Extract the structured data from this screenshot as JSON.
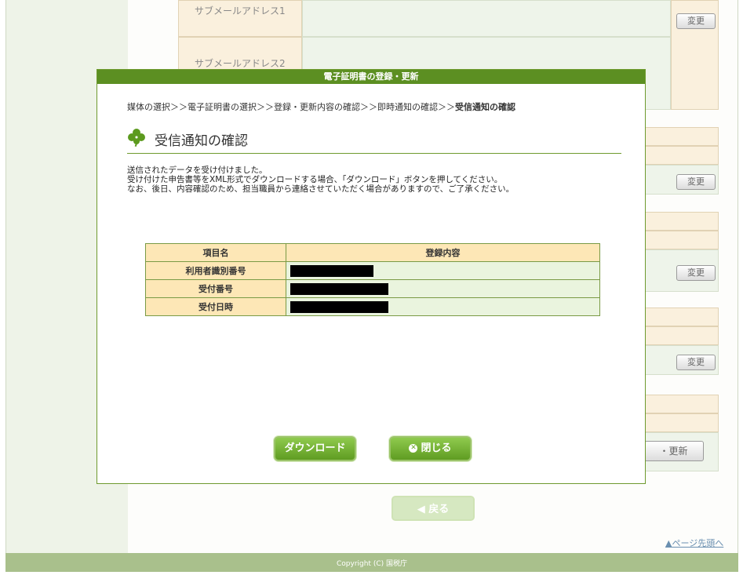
{
  "background": {
    "sub_mail_1_label": "サブメールアドレス1",
    "sub_mail_2_label": "サブメールアドレス2",
    "change_label": "変更",
    "register_update_label": "・更新",
    "back_label": "戻る",
    "page_top_label": "ページ先頭へ",
    "footer_copyright": "Copyright (C) 国税庁"
  },
  "modal": {
    "title": "電子証明書の登録・更新",
    "breadcrumb": {
      "trail": "媒体の選択＞＞電子証明書の選択＞＞登録・更新内容の確認＞＞即時通知の確認＞＞",
      "current": "受信通知の確認"
    },
    "heading": "受信通知の確認",
    "messages": [
      "送信されたデータを受け付けました。",
      "受け付けた申告書等をXML形式でダウンロードする場合、「ダウンロード」ボタンを押してください。",
      "なお、後日、内容確認のため、担当職員から連絡させていただく場合がありますので、ご了承ください。"
    ],
    "table": {
      "headers": [
        "項目名",
        "登録内容"
      ],
      "rows": [
        {
          "label": "利用者識別番号"
        },
        {
          "label": "受付番号"
        },
        {
          "label": "受付日時"
        }
      ]
    },
    "download_label": "ダウンロード",
    "close_label": "閉じる"
  },
  "colors": {
    "accent_green": "#5c8f22",
    "label_bg": "#fde7b6",
    "value_bg": "#eaf4de"
  }
}
